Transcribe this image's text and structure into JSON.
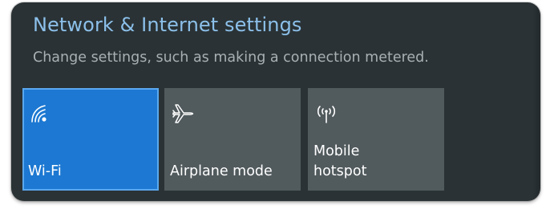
{
  "panel": {
    "title": "Network & Internet settings",
    "subtitle": "Change settings, such as making a connection metered."
  },
  "tiles": [
    {
      "label": "Wi-Fi",
      "icon": "wifi-icon",
      "state": "on"
    },
    {
      "label": "Airplane mode",
      "icon": "airplane-icon",
      "state": "off"
    },
    {
      "label_line1": "Mobile",
      "label_line2": "hotspot",
      "icon": "mobile-hotspot-icon",
      "state": "off"
    }
  ],
  "colors": {
    "panel_bg": "#2a3235",
    "title": "#8cc0ea",
    "subtitle": "#a9b0b3",
    "tile_on": "#1c78d2",
    "tile_off": "#515a5d"
  }
}
